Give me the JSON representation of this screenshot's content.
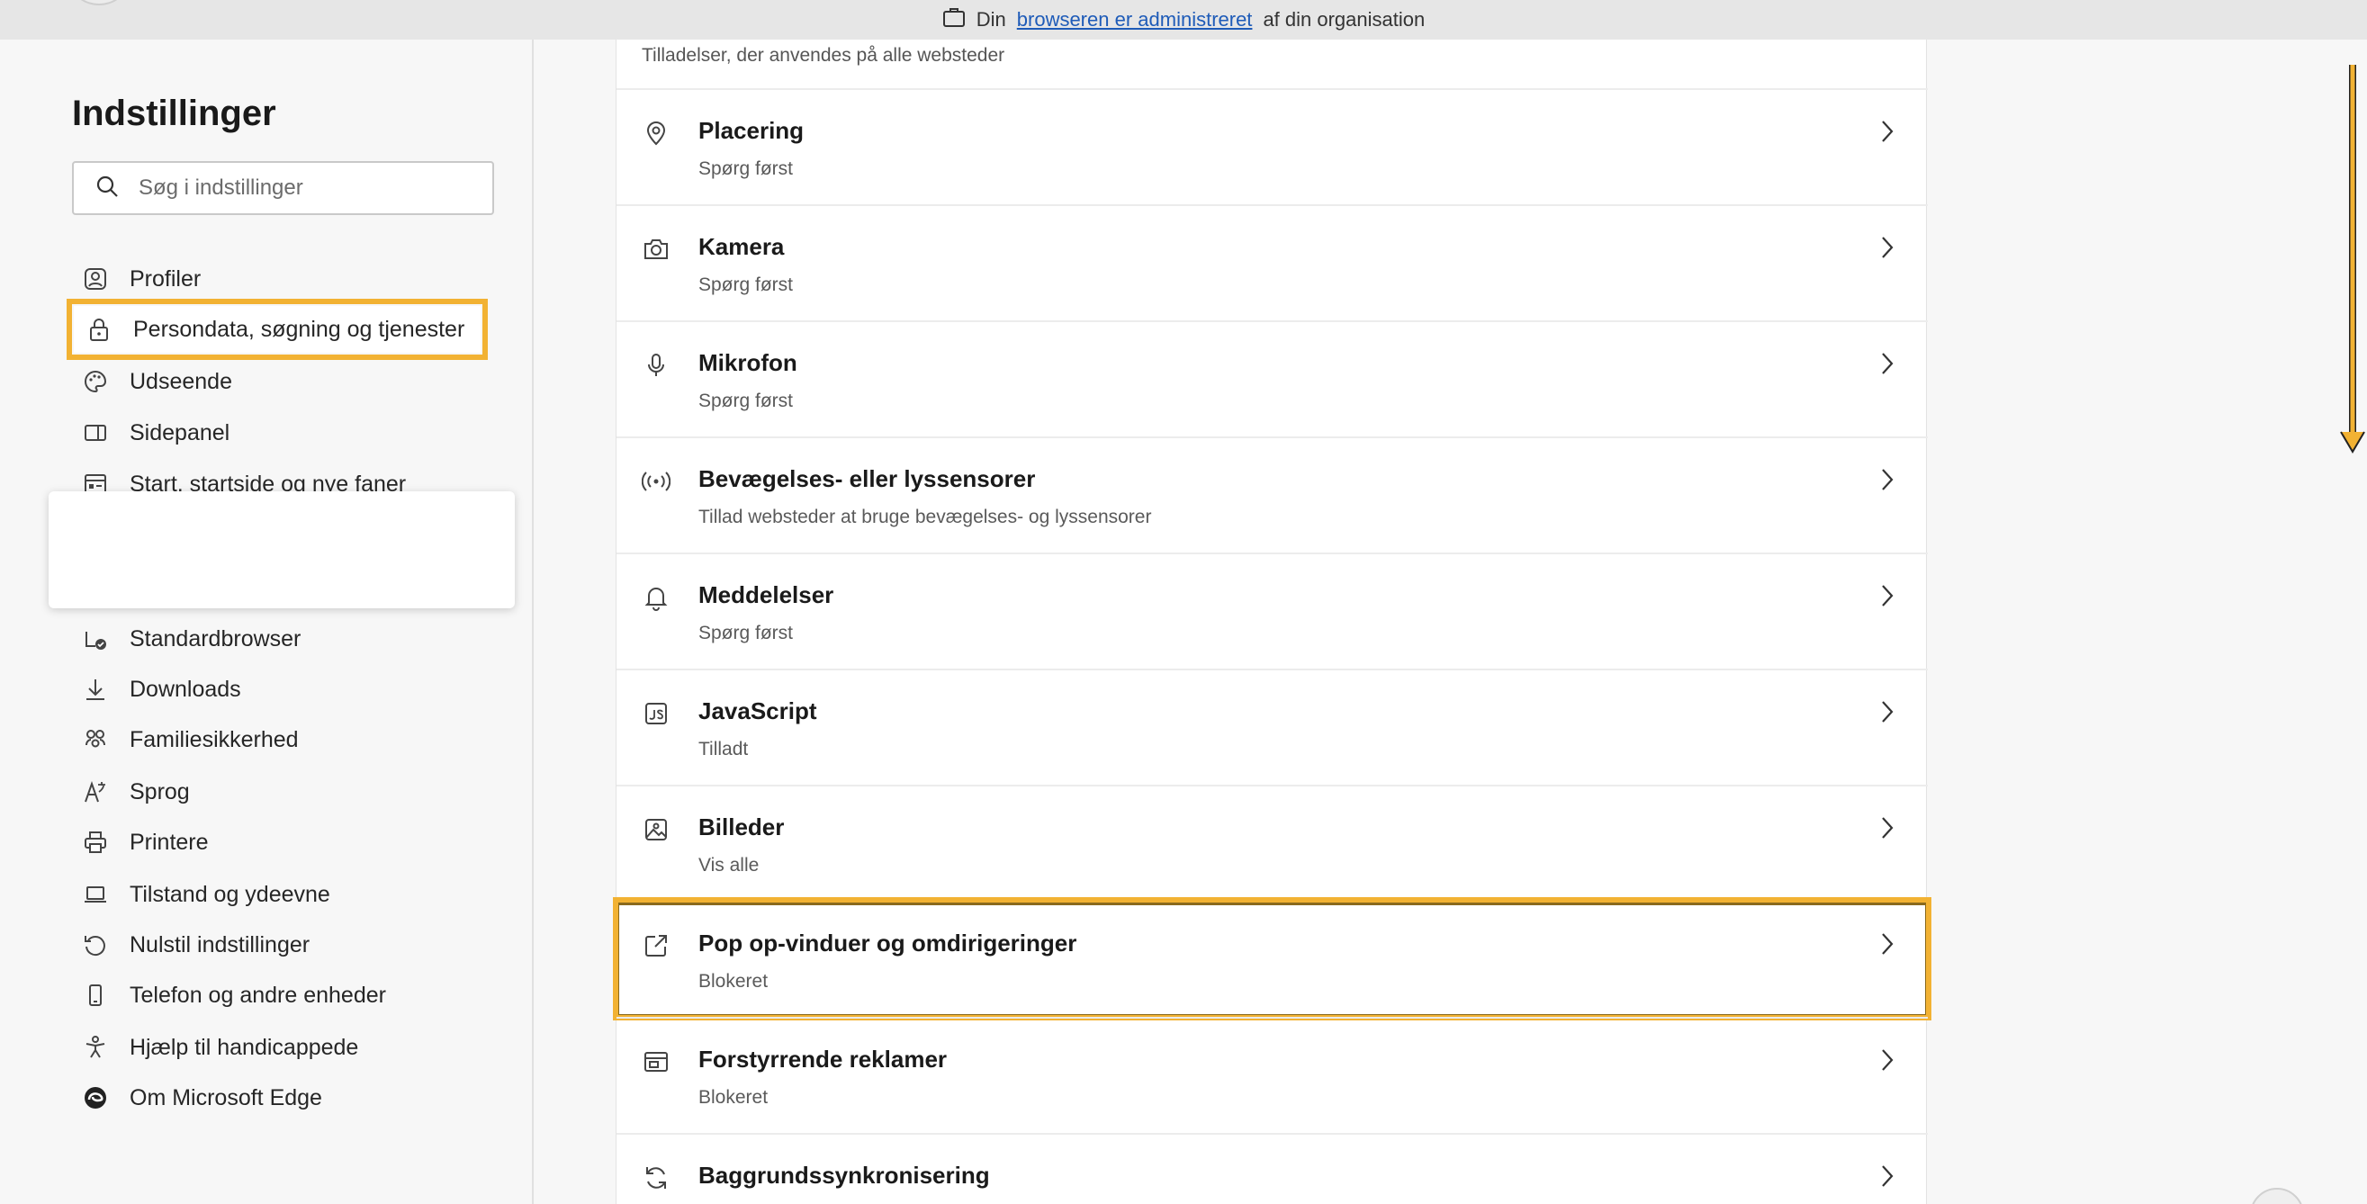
{
  "topbar": {
    "prefix": "Din",
    "link": "browseren er administreret",
    "suffix": "af din organisation"
  },
  "sidebar": {
    "title": "Indstillinger",
    "search_placeholder": "Søg i indstillinger",
    "items": [
      {
        "label": "Profiler",
        "icon": "profile-icon"
      },
      {
        "label": "Persondata, søgning og tjenester",
        "icon": "lock-icon",
        "highlighted": true
      },
      {
        "label": "Udseende",
        "icon": "palette-icon"
      },
      {
        "label": "Sidepanel",
        "icon": "sidepanel-icon"
      },
      {
        "label": "Start, startside og nye faner",
        "icon": "home-icon"
      },
      {
        "label": "Standardbrowser",
        "icon": "default-browser-icon"
      },
      {
        "label": "Downloads",
        "icon": "download-icon"
      },
      {
        "label": "Familiesikkerhed",
        "icon": "family-icon"
      },
      {
        "label": "Sprog",
        "icon": "language-icon"
      },
      {
        "label": "Printere",
        "icon": "printer-icon"
      },
      {
        "label": "Tilstand og ydeevne",
        "icon": "laptop-icon"
      },
      {
        "label": "Nulstil indstillinger",
        "icon": "reset-icon"
      },
      {
        "label": "Telefon og andre enheder",
        "icon": "phone-icon"
      },
      {
        "label": "Hjælp til handicappede",
        "icon": "accessibility-icon"
      },
      {
        "label": "Om Microsoft Edge",
        "icon": "edge-icon"
      }
    ]
  },
  "content": {
    "section_label": "Tilladelser, der anvendes på alle websteder",
    "rows": [
      {
        "title": "Placering",
        "sub": "Spørg først",
        "icon": "location-icon"
      },
      {
        "title": "Kamera",
        "sub": "Spørg først",
        "icon": "camera-icon"
      },
      {
        "title": "Mikrofon",
        "sub": "Spørg først",
        "icon": "microphone-icon"
      },
      {
        "title": "Bevægelses- eller lyssensorer",
        "sub": "Tillad websteder at bruge bevægelses- og lyssensorer",
        "icon": "sensor-icon"
      },
      {
        "title": "Meddelelser",
        "sub": "Spørg først",
        "icon": "bell-icon"
      },
      {
        "title": "JavaScript",
        "sub": "Tilladt",
        "icon": "javascript-icon"
      },
      {
        "title": "Billeder",
        "sub": "Vis alle",
        "icon": "image-icon"
      },
      {
        "title": "Pop op-vinduer og omdirigeringer",
        "sub": "Blokeret",
        "icon": "popup-icon",
        "highlighted": true
      },
      {
        "title": "Forstyrrende reklamer",
        "sub": "Blokeret",
        "icon": "ads-icon"
      },
      {
        "title": "Baggrundssynkronisering",
        "sub": "",
        "icon": "sync-icon"
      }
    ]
  },
  "colors": {
    "highlight": "#f2b233",
    "link": "#1e5bb8"
  }
}
